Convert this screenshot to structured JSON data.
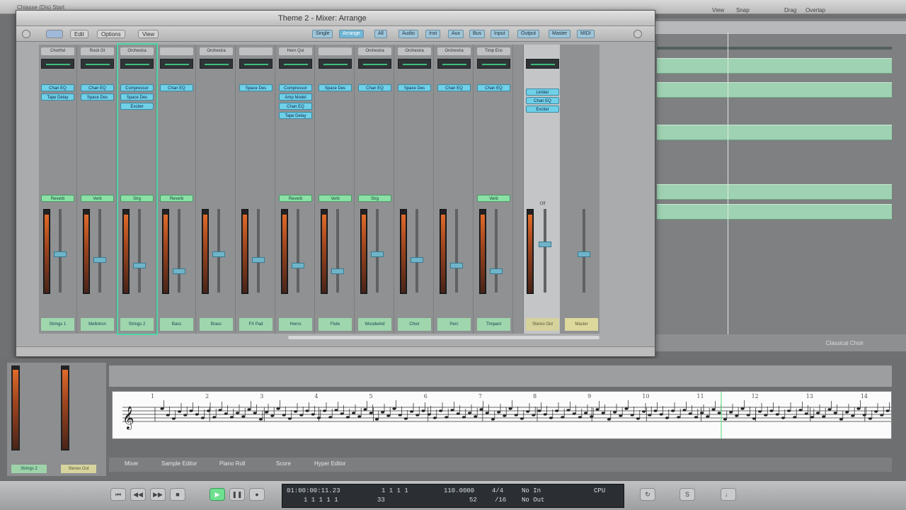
{
  "topbar": {
    "title": "Chiasse (Dis) Start",
    "right_items": [
      "View",
      "Snap",
      "Drag",
      "Overlap"
    ]
  },
  "mixer": {
    "window_title": "Theme 2 - Mixer: Arrange",
    "menus": [
      "Edit",
      "Options",
      "View"
    ],
    "filter_buttons": [
      "Single",
      "Arrange",
      "All",
      "Audio",
      "Inst",
      "Aux",
      "Bus",
      "Input",
      "Output",
      "Master",
      "MIDI"
    ],
    "channels": [
      {
        "name": "Chorlhd",
        "insert": [
          "Chan EQ",
          "Tape Delay"
        ],
        "send": "Reverb",
        "plate": "Strings 1",
        "sel": false
      },
      {
        "name": "Rock Gt",
        "insert": [
          "Chan EQ",
          "Space Des"
        ],
        "send": "Verb",
        "plate": "Mellotron",
        "sel": false
      },
      {
        "name": "Orchestra",
        "insert": [
          "Compressor",
          "Space Des",
          "Exciter"
        ],
        "send": "Strg",
        "plate": "Strings 2",
        "sel": true
      },
      {
        "name": "",
        "insert": [
          "Chan EQ"
        ],
        "send": "Reverb",
        "plate": "Bass",
        "sel": false
      },
      {
        "name": "Orchestra",
        "insert": [],
        "send": "",
        "plate": "Brass",
        "sel": false
      },
      {
        "name": "",
        "insert": [
          "Space Des"
        ],
        "send": "",
        "plate": "FX Pad",
        "sel": false
      },
      {
        "name": "Horn Qui",
        "insert": [
          "Compressor",
          "Amp Model",
          "Chan EQ",
          "Tape Delay"
        ],
        "send": "Reverb",
        "plate": "Horns",
        "sel": false
      },
      {
        "name": "",
        "insert": [
          "Space Des"
        ],
        "send": "Verb",
        "plate": "Flute",
        "sel": false
      },
      {
        "name": "Orchestra",
        "insert": [
          "Chan EQ"
        ],
        "send": "Strg",
        "plate": "Woodwind",
        "sel": false
      },
      {
        "name": "Orchestra",
        "insert": [
          "Space Des"
        ],
        "send": "",
        "plate": "Choir",
        "sel": false
      },
      {
        "name": "Orchestra",
        "insert": [
          "Chan EQ"
        ],
        "send": "",
        "plate": "Perc",
        "sel": false
      },
      {
        "name": "Timp Ens",
        "insert": [
          "Chan EQ"
        ],
        "send": "Verb",
        "plate": "Timpani",
        "sel": false
      }
    ],
    "output": {
      "label": "Stereo Out",
      "inserts": [
        "Limiter",
        "Chan EQ",
        "Exciter"
      ],
      "state": "Off"
    },
    "master": {
      "label": "Master"
    }
  },
  "arrange": {
    "label": "Classical Choir"
  },
  "score": {
    "bar_numbers": [
      "1",
      "2",
      "3",
      "4",
      "5",
      "6",
      "7",
      "8",
      "9",
      "10",
      "11",
      "12",
      "13",
      "14"
    ]
  },
  "lower_tabs": [
    "Mixer",
    "Sample Editor",
    "Piano Roll",
    "Score",
    "Hyper Editor"
  ],
  "inspector": {
    "left_plate": "Strings 2",
    "right_plate": "Stereo Out"
  },
  "transport": {
    "smpte": "01:00:00:11.23",
    "sub": "1  1  1  1  1",
    "bars": "1  1  1  1",
    "tempo": "110.0000",
    "signature": "4/4",
    "in": "No In",
    "out": "No Out",
    "division": "/16",
    "value52": "52",
    "value33": "33",
    "mode": "CPU"
  }
}
